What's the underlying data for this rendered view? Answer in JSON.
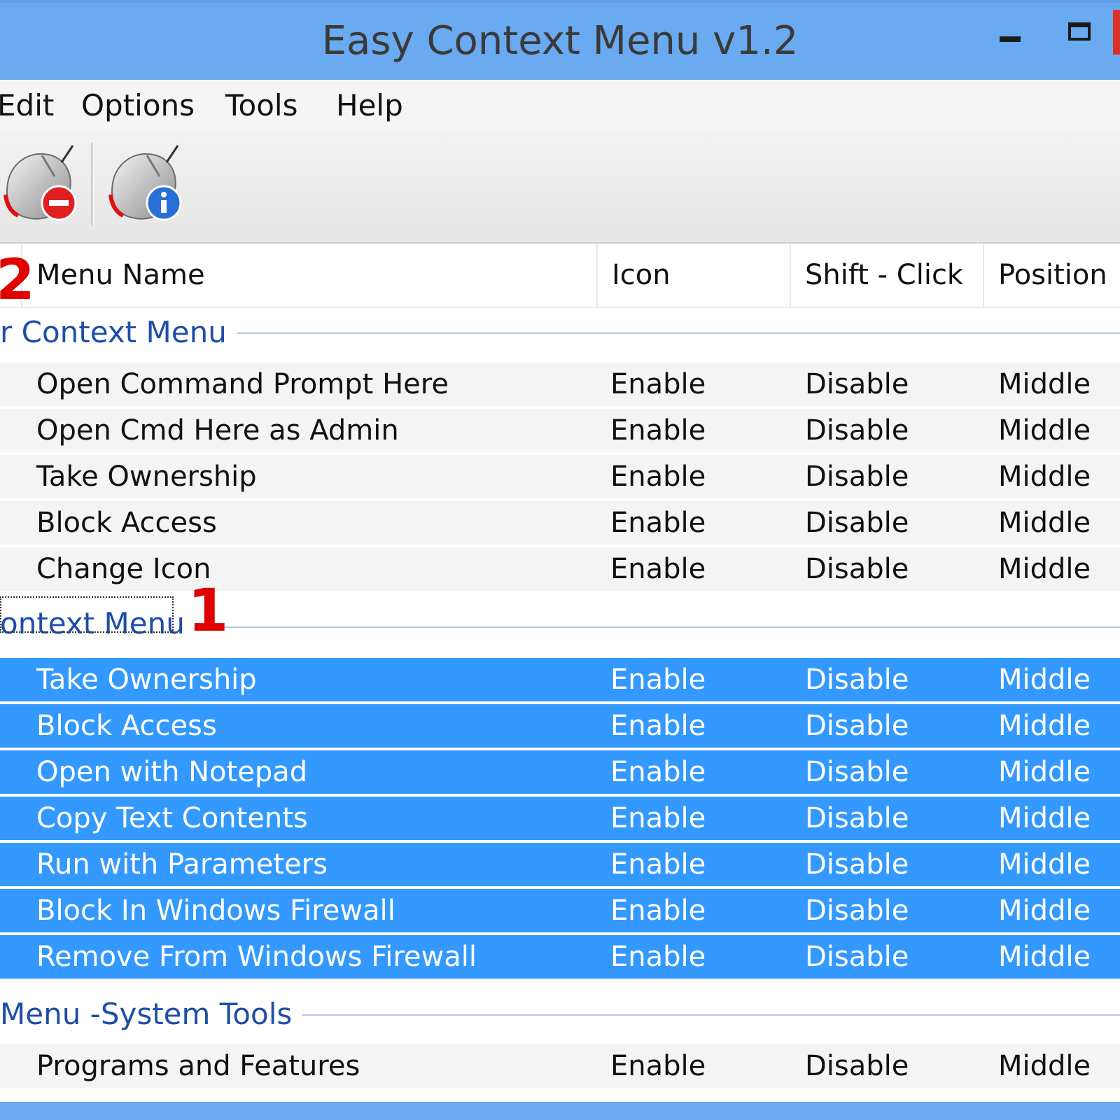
{
  "window": {
    "title": "Easy Context Menu v1.2"
  },
  "menubar": {
    "items": [
      "Edit",
      "Options",
      "Tools",
      "Help"
    ]
  },
  "toolbar": {
    "buttons": [
      {
        "icon": "mouse-remove-icon"
      },
      {
        "icon": "mouse-info-icon"
      }
    ]
  },
  "annotations": {
    "marker1": "1",
    "marker2": "2"
  },
  "columns": {
    "name": "Menu Name",
    "icon": "Icon",
    "shift": "Shift - Click",
    "position": "Position"
  },
  "groups": [
    {
      "title": "r Context Menu",
      "rows": [
        {
          "name": "Open Command Prompt Here",
          "icon": "Enable",
          "shift": "Disable",
          "position": "Middle"
        },
        {
          "name": "Open Cmd Here as Admin",
          "icon": "Enable",
          "shift": "Disable",
          "position": "Middle"
        },
        {
          "name": "Take Ownership",
          "icon": "Enable",
          "shift": "Disable",
          "position": "Middle"
        },
        {
          "name": "Block Access",
          "icon": "Enable",
          "shift": "Disable",
          "position": "Middle"
        },
        {
          "name": "Change Icon",
          "icon": "Enable",
          "shift": "Disable",
          "position": "Middle"
        }
      ]
    },
    {
      "title": "ontext Menu",
      "rows": [
        {
          "name": "Take Ownership",
          "icon": "Enable",
          "shift": "Disable",
          "position": "Middle"
        },
        {
          "name": "Block Access",
          "icon": "Enable",
          "shift": "Disable",
          "position": "Middle"
        },
        {
          "name": "Open with Notepad",
          "icon": "Enable",
          "shift": "Disable",
          "position": "Middle"
        },
        {
          "name": "Copy Text Contents",
          "icon": "Enable",
          "shift": "Disable",
          "position": "Middle"
        },
        {
          "name": "Run with Parameters",
          "icon": "Enable",
          "shift": "Disable",
          "position": "Middle"
        },
        {
          "name": "Block In Windows Firewall",
          "icon": "Enable",
          "shift": "Disable",
          "position": "Middle"
        },
        {
          "name": "Remove From Windows Firewall",
          "icon": "Enable",
          "shift": "Disable",
          "position": "Middle"
        }
      ]
    },
    {
      "title": "Menu -System Tools",
      "rows": [
        {
          "name": "Programs and Features",
          "icon": "Enable",
          "shift": "Disable",
          "position": "Middle"
        }
      ]
    }
  ],
  "colors": {
    "titlebar": "#6aaaf0",
    "selection": "#3399ff",
    "group_title": "#1e4ea6",
    "annotation": "#e00000"
  }
}
